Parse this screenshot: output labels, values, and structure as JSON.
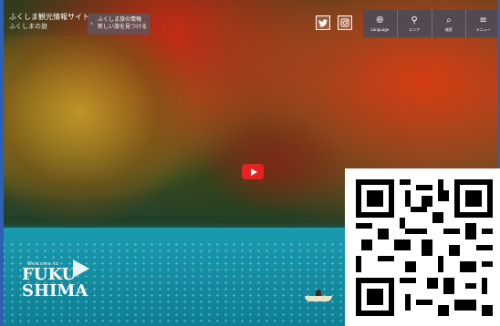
{
  "header": {
    "site_title": "ふくしま観光情報サイト",
    "site_subtitle": "ふくしまの旅",
    "notice_line1": "ふくしま旅の情報",
    "notice_line2": "新しい旅を見つける"
  },
  "social": {
    "twitter_icon": "twitter-icon",
    "instagram_icon": "instagram-icon"
  },
  "nav": {
    "items": [
      {
        "label": "Language",
        "icon": "globe-icon"
      },
      {
        "label": "エリア",
        "icon": "map-pin-icon"
      },
      {
        "label": "検索",
        "icon": "search-icon"
      },
      {
        "label": "メニュー",
        "icon": "menu-icon"
      }
    ]
  },
  "hero": {
    "logo_welcome": "Welcome to",
    "logo_line1": "FUKU",
    "logo_line2": "SHIMA"
  },
  "colors": {
    "accent": "#2f5fb0",
    "play": "#e52222"
  }
}
